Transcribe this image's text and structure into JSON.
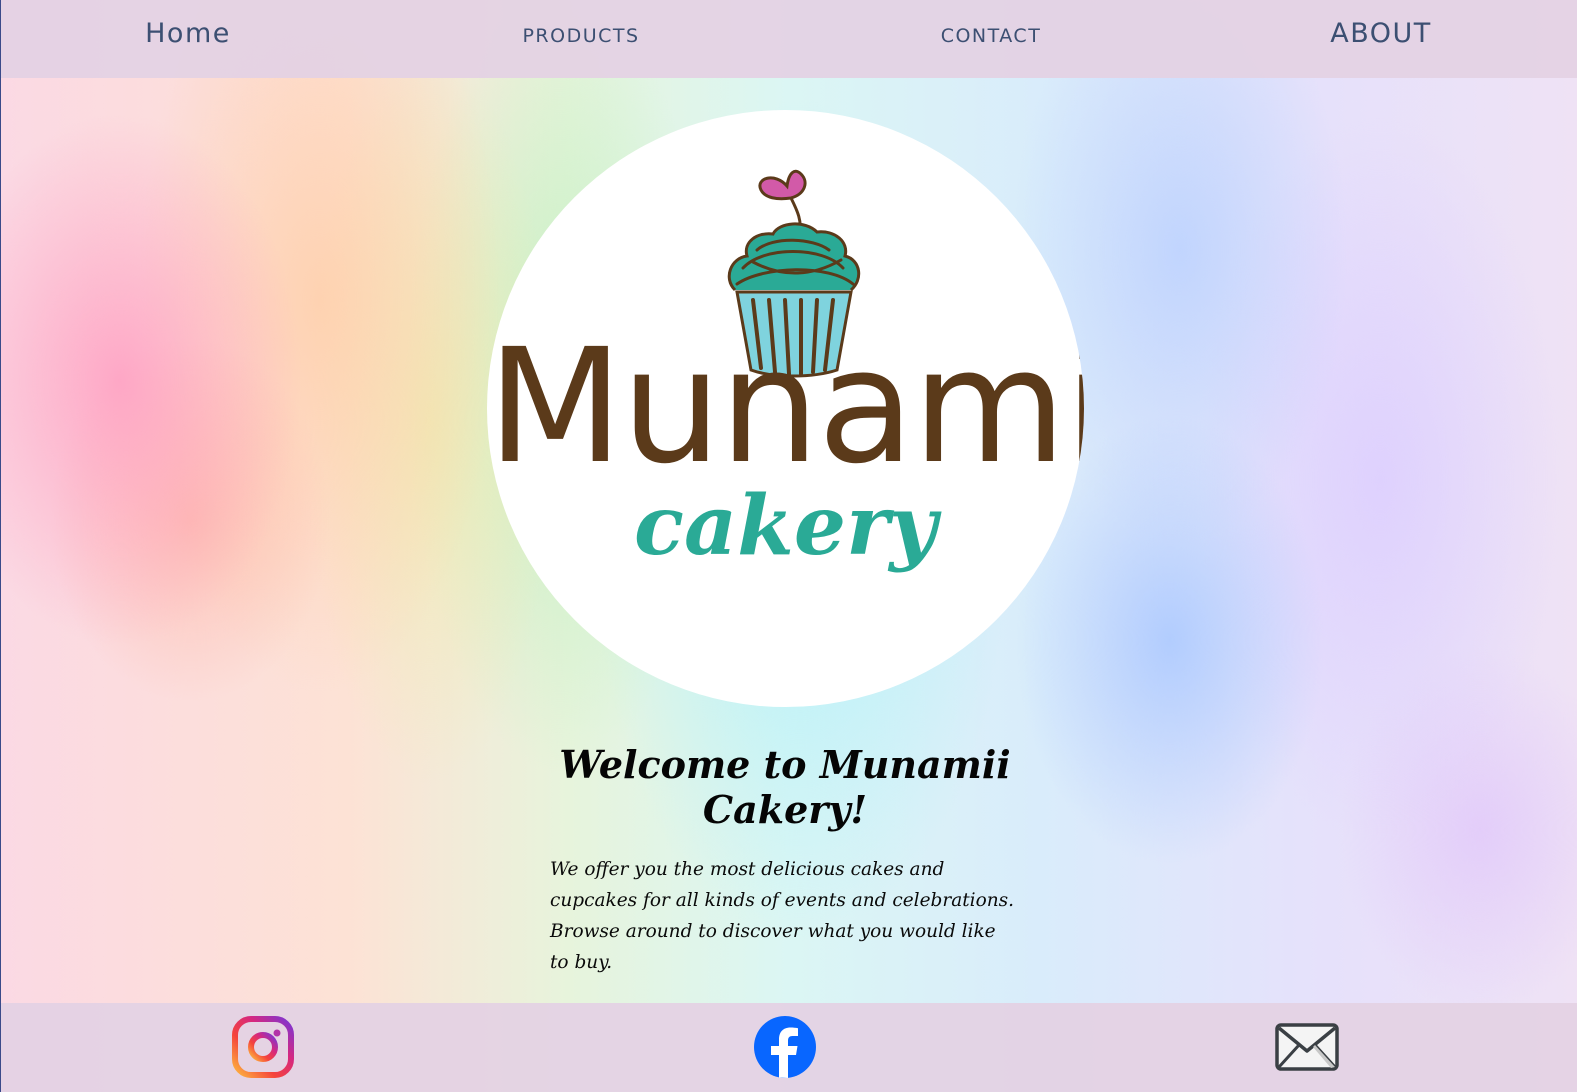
{
  "nav": {
    "items": [
      {
        "label": "Home"
      },
      {
        "label": "PRODUCTS"
      },
      {
        "label": "CONTACT"
      },
      {
        "label": "ABOUT"
      }
    ]
  },
  "hero": {
    "logo": {
      "brand_name": "Munamii",
      "brand_sub": "cakery",
      "icon": "cupcake-heart-icon"
    }
  },
  "welcome": {
    "title": "Welcome to Munamii Cakery!",
    "text": "We offer you the most delicious cakes and cupcakes for all kinds of events and celebrations. Browse around to discover what you would like to buy."
  },
  "footer": {
    "social": [
      {
        "icon": "instagram-icon"
      },
      {
        "icon": "facebook-icon"
      },
      {
        "icon": "mail-icon"
      }
    ]
  },
  "colors": {
    "nav_bar": "#e4d2e4",
    "nav_text": "#3c4f72",
    "brand_brown": "#5b3a1a",
    "brand_teal": "#2aaa96",
    "heart_pink": "#d25aa8",
    "facebook_blue": "#0866ff"
  }
}
